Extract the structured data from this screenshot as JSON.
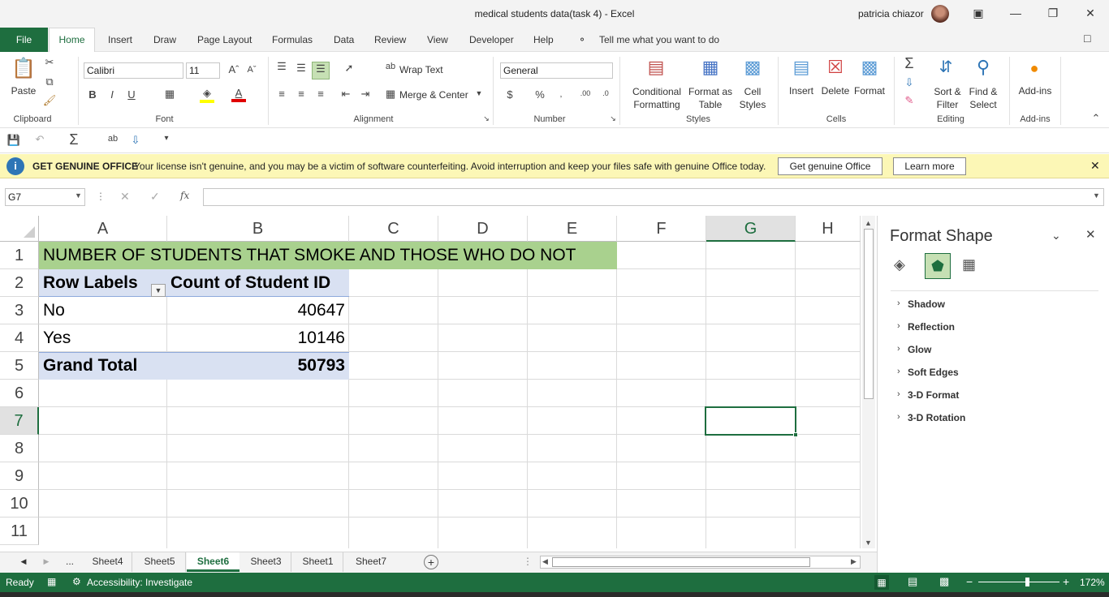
{
  "window": {
    "title": "medical students data(task 4)  -  Excel",
    "user": "patricia chiazor",
    "ribbon_display_icon": "ribbon-display-options-icon"
  },
  "tabs": [
    "File",
    "Home",
    "Insert",
    "Draw",
    "Page Layout",
    "Formulas",
    "Data",
    "Review",
    "View",
    "Developer",
    "Help"
  ],
  "tell_me": "Tell me what you want to do",
  "ribbon": {
    "paste": "Paste",
    "font_name": "Calibri",
    "font_size": "11",
    "wrap_text": "Wrap Text",
    "merge_center": "Merge & Center",
    "number_format": "General",
    "conditional": [
      "Conditional",
      "Formatting"
    ],
    "format_table": [
      "Format as",
      "Table"
    ],
    "cell_styles": [
      "Cell",
      "Styles"
    ],
    "insert": "Insert",
    "delete": "Delete",
    "format": "Format",
    "sort_filter": [
      "Sort &",
      "Filter"
    ],
    "find_select": [
      "Find &",
      "Select"
    ],
    "addins": "Add-ins",
    "groups": [
      "Clipboard",
      "Font",
      "Alignment",
      "Number",
      "Styles",
      "Cells",
      "Editing",
      "Add-ins"
    ],
    "bold": "B",
    "italic": "I",
    "underline": "U"
  },
  "infobar": {
    "title": "GET GENUINE OFFICE",
    "message": "Your license isn't genuine, and you may be a victim of software counterfeiting. Avoid interruption and keep your files safe with genuine Office today.",
    "btn_genuine": "Get genuine Office",
    "btn_learn": "Learn more"
  },
  "formula_bar": {
    "name_box": "G7",
    "formula": ""
  },
  "grid": {
    "columns": [
      "A",
      "B",
      "C",
      "D",
      "E",
      "F",
      "G",
      "H"
    ],
    "rows": [
      "1",
      "2",
      "3",
      "4",
      "5",
      "6",
      "7",
      "8",
      "9",
      "10",
      "11"
    ],
    "title_cell": "NUMBER OF STUDENTS THAT SMOKE AND THOSE WHO DO NOT",
    "pivot_header_row_labels": "Row Labels",
    "pivot_header_count": "Count of Student ID",
    "pivot_rows": [
      {
        "label": "No",
        "value": "40647"
      },
      {
        "label": "Yes",
        "value": "10146"
      }
    ],
    "grand_total_label": "Grand Total",
    "grand_total_value": "50793",
    "selected_cell": "G7"
  },
  "sheets": {
    "more": "...",
    "tabs": [
      "Sheet4",
      "Sheet5",
      "Sheet6",
      "Sheet3",
      "Sheet1",
      "Sheet7"
    ],
    "active": "Sheet6"
  },
  "status": {
    "ready": "Ready",
    "accessibility": "Accessibility: Investigate",
    "zoom": "172%"
  },
  "format_pane": {
    "title": "Format Shape",
    "sections": [
      "Shadow",
      "Reflection",
      "Glow",
      "Soft Edges",
      "3-D Format",
      "3-D Rotation"
    ]
  },
  "colors": {
    "excel_green": "#1e6e3f",
    "title_fill": "#a9d18e",
    "pivot_fill": "#d9e1f2",
    "infobar": "#fcf7b6"
  }
}
